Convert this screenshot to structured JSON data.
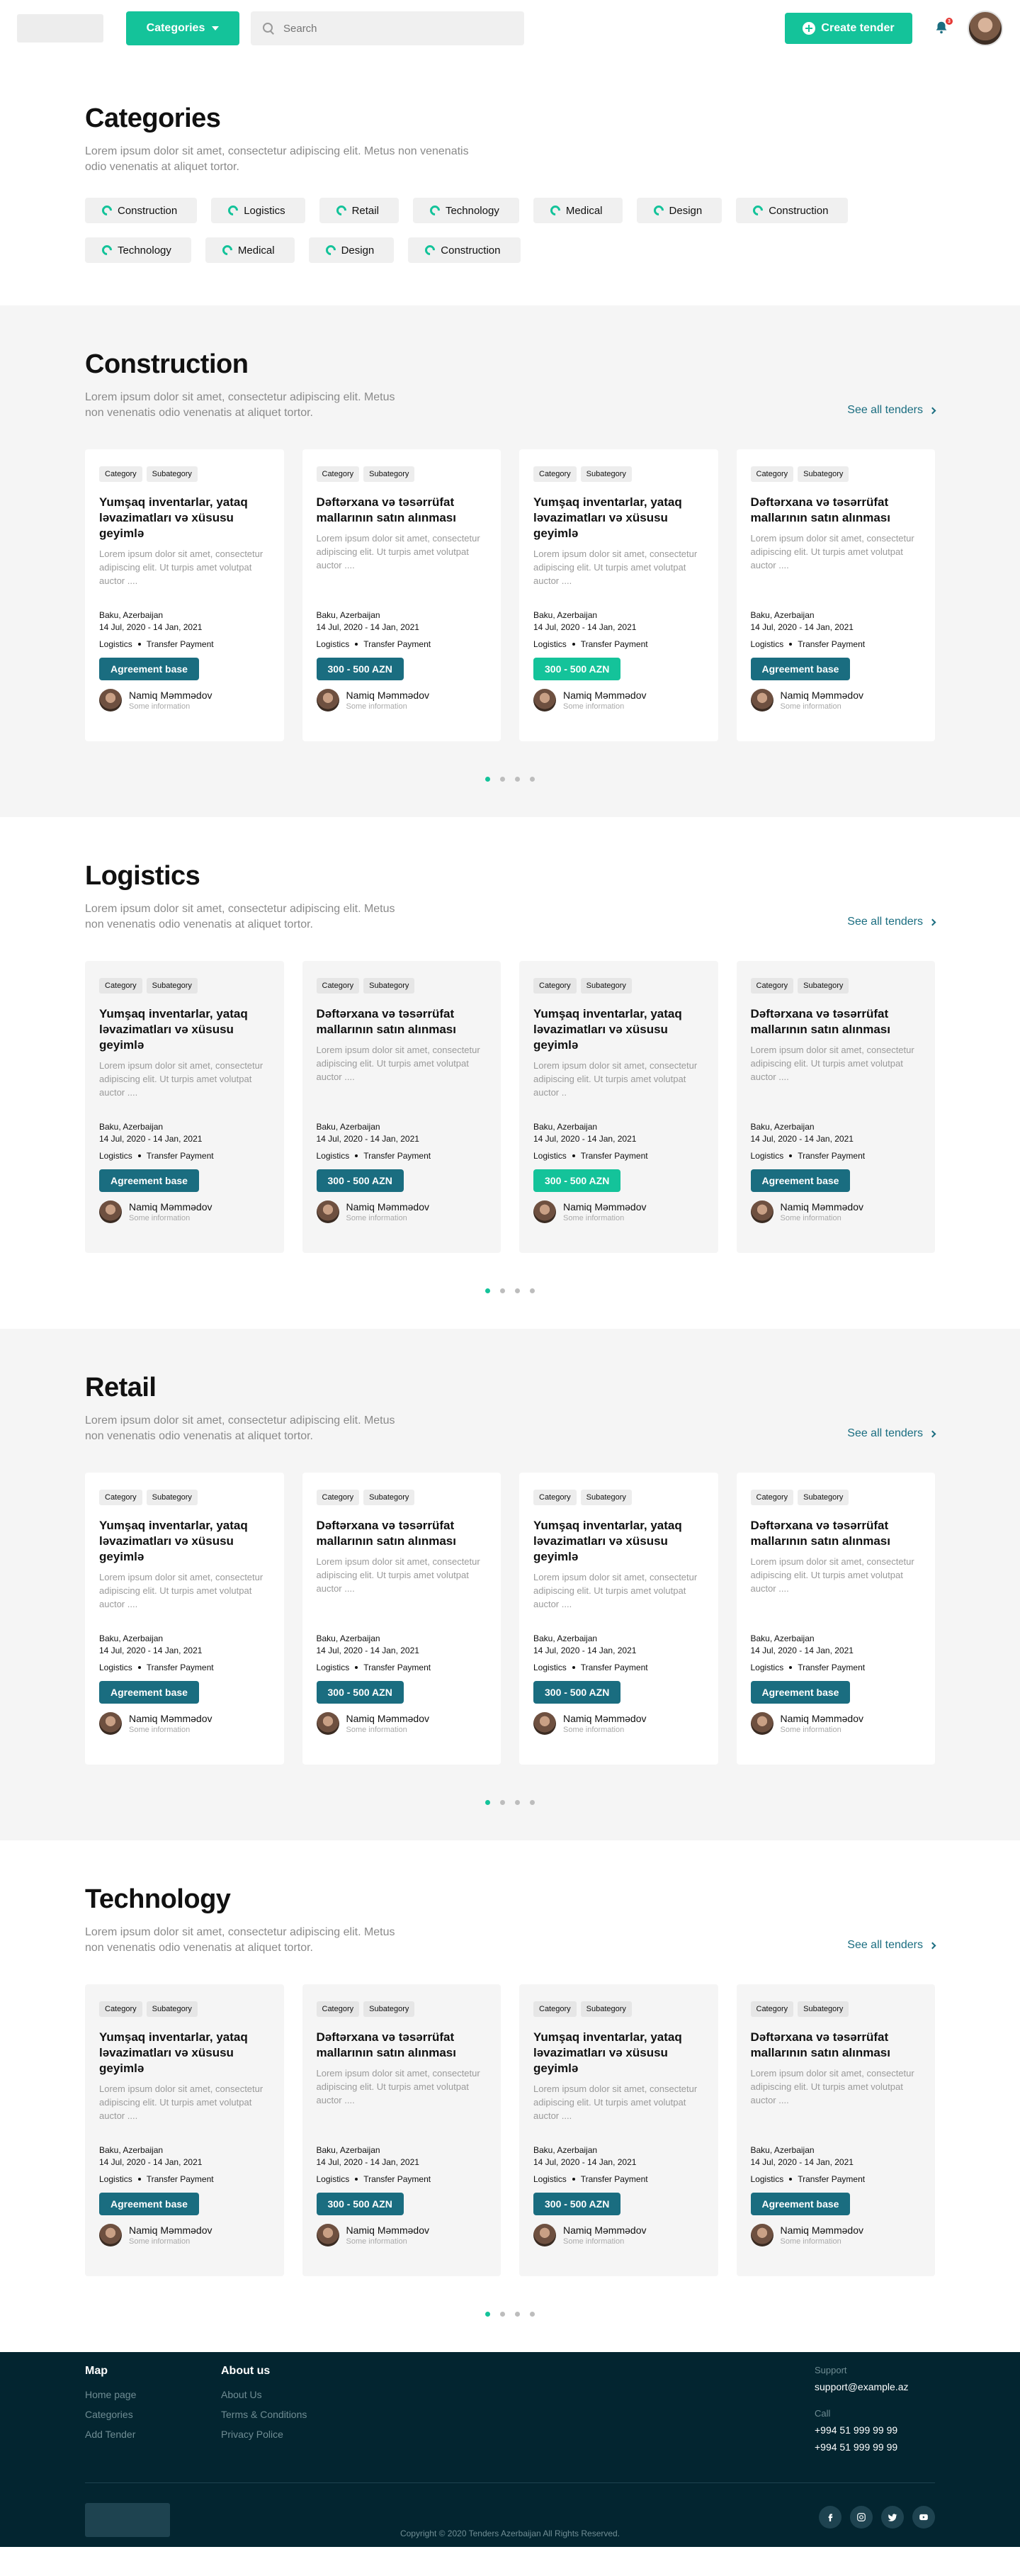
{
  "header": {
    "categories_label": "Categories",
    "search_placeholder": "Search",
    "create_label": "Create tender",
    "notification_count": "3"
  },
  "categories": {
    "title": "Categories",
    "description": "Lorem ipsum dolor sit amet, consectetur adipiscing elit. Metus non venenatis odio venenatis at aliquet tortor.",
    "chips": [
      "Construction",
      "Logistics",
      "Retail",
      "Technology",
      "Medical",
      "Design",
      "Construction",
      "Technology",
      "Medical",
      "Design",
      "Construction"
    ]
  },
  "sections": [
    {
      "title": "Construction",
      "description": "Lorem ipsum dolor sit amet, consectetur adipiscing elit. Metus non venenatis odio venenatis at aliquet tortor.",
      "see_all": "See all tenders",
      "cards": [
        {
          "category": "Category",
          "subcategory": "Subategory",
          "title": "Yumşaq inventarlar, yataq ləvazimatları və xüsusu geyimlə",
          "desc": "Lorem ipsum dolor sit amet, consectetur adipiscing elit. Ut turpis amet volutpat auctor ....",
          "location": "Baku, Azerbaijan",
          "dates": "14 Jul, 2020 - 14 Jan, 2021",
          "meta1": "Logistics",
          "meta2": "Transfer Payment",
          "price": "Agreement base",
          "user": "Namiq Məmmədov",
          "user_info": "Some information"
        },
        {
          "category": "Category",
          "subcategory": "Subategory",
          "title": "Dəftərxana və təsərrüfat mallarının satın alınması",
          "desc": "Lorem ipsum dolor sit amet, consectetur adipiscing elit. Ut turpis amet volutpat auctor ....",
          "location": "Baku, Azerbaijan",
          "dates": "14 Jul, 2020 - 14 Jan, 2021",
          "meta1": "Logistics",
          "meta2": "Transfer Payment",
          "price": "300 - 500 AZN",
          "user": "Namiq Məmmədov",
          "user_info": "Some information"
        },
        {
          "category": "Category",
          "subcategory": "Subategory",
          "title": "Yumşaq inventarlar, yataq ləvazimatları və xüsusu geyimlə",
          "desc": "Lorem ipsum dolor sit amet, consectetur adipiscing elit. Ut turpis amet volutpat auctor ....",
          "location": "Baku, Azerbaijan",
          "dates": "14 Jul, 2020 - 14 Jan, 2021",
          "meta1": "Logistics",
          "meta2": "Transfer Payment",
          "price": "300 - 500 AZN",
          "user": "Namiq Məmmədov",
          "user_info": "Some information"
        },
        {
          "category": "Category",
          "subcategory": "Subategory",
          "title": "Dəftərxana və təsərrüfat mallarının satın alınması",
          "desc": "Lorem ipsum dolor sit amet, consectetur adipiscing elit. Ut turpis amet volutpat auctor ....",
          "location": "Baku, Azerbaijan",
          "dates": "14 Jul, 2020 - 14 Jan, 2021",
          "meta1": "Logistics",
          "meta2": "Transfer Payment",
          "price": "Agreement base",
          "user": "Namiq Məmmədov",
          "user_info": "Some information"
        }
      ]
    },
    {
      "title": "Logistics",
      "description": "Lorem ipsum dolor sit amet, consectetur adipiscing elit. Metus non venenatis odio venenatis at aliquet tortor.",
      "see_all": "See all tenders",
      "cards": [
        {
          "category": "Category",
          "subcategory": "Subategory",
          "title": "Yumşaq inventarlar, yataq ləvazimatları və xüsusu geyimlə",
          "desc": "Lorem ipsum dolor sit amet, consectetur adipiscing elit. Ut turpis amet volutpat auctor ....",
          "location": "Baku, Azerbaijan",
          "dates": "14 Jul, 2020 - 14 Jan, 2021",
          "meta1": "Logistics",
          "meta2": "Transfer Payment",
          "price": "Agreement base",
          "user": "Namiq Məmmədov",
          "user_info": "Some information"
        },
        {
          "category": "Category",
          "subcategory": "Subategory",
          "title": "Dəftərxana və təsərrüfat mallarının satın alınması",
          "desc": "Lorem ipsum dolor sit amet, consectetur adipiscing elit. Ut turpis amet volutpat auctor ....",
          "location": "Baku, Azerbaijan",
          "dates": "14 Jul, 2020 - 14 Jan, 2021",
          "meta1": "Logistics",
          "meta2": "Transfer Payment",
          "price": "300 - 500 AZN",
          "user": "Namiq Məmmədov",
          "user_info": "Some information"
        },
        {
          "category": "Category",
          "subcategory": "Subategory",
          "title": "Yumşaq inventarlar, yataq ləvazimatları və xüsusu geyimlə",
          "desc": "Lorem ipsum dolor sit amet, consectetur adipiscing elit. Ut turpis amet volutpat auctor ..",
          "location": "Baku, Azerbaijan",
          "dates": "14 Jul, 2020 - 14 Jan, 2021",
          "meta1": "Logistics",
          "meta2": "Transfer Payment",
          "price": "300 - 500 AZN",
          "user": "Namiq Məmmədov",
          "user_info": "Some information"
        },
        {
          "category": "Category",
          "subcategory": "Subategory",
          "title": "Dəftərxana və təsərrüfat mallarının satın alınması",
          "desc": "Lorem ipsum dolor sit amet, consectetur adipiscing elit. Ut turpis amet volutpat auctor ....",
          "location": "Baku, Azerbaijan",
          "dates": "14 Jul, 2020 - 14 Jan, 2021",
          "meta1": "Logistics",
          "meta2": "Transfer Payment",
          "price": "Agreement base",
          "user": "Namiq Məmmədov",
          "user_info": "Some information"
        }
      ]
    },
    {
      "title": "Retail",
      "description": "Lorem ipsum dolor sit amet, consectetur adipiscing elit. Metus non venenatis odio venenatis at aliquet tortor.",
      "see_all": "See all tenders",
      "cards": [
        {
          "category": "Category",
          "subcategory": "Subategory",
          "title": "Yumşaq inventarlar, yataq ləvazimatları və xüsusu geyimlə",
          "desc": "Lorem ipsum dolor sit amet, consectetur adipiscing elit. Ut turpis amet volutpat auctor ....",
          "location": "Baku, Azerbaijan",
          "dates": "14 Jul, 2020 - 14 Jan, 2021",
          "meta1": "Logistics",
          "meta2": "Transfer Payment",
          "price": "Agreement base",
          "user": "Namiq Məmmədov",
          "user_info": "Some information"
        },
        {
          "category": "Category",
          "subcategory": "Subategory",
          "title": "Dəftərxana və təsərrüfat mallarının satın alınması",
          "desc": "Lorem ipsum dolor sit amet, consectetur adipiscing elit. Ut turpis amet volutpat auctor ....",
          "location": "Baku, Azerbaijan",
          "dates": "14 Jul, 2020 - 14 Jan, 2021",
          "meta1": "Logistics",
          "meta2": "Transfer Payment",
          "price": "300 - 500 AZN",
          "user": "Namiq Məmmədov",
          "user_info": "Some information"
        },
        {
          "category": "Category",
          "subcategory": "Subategory",
          "title": "Yumşaq inventarlar, yataq ləvazimatları və xüsusu geyimlə",
          "desc": "Lorem ipsum dolor sit amet, consectetur adipiscing elit. Ut turpis amet volutpat auctor ....",
          "location": "Baku, Azerbaijan",
          "dates": "14 Jul, 2020 - 14 Jan, 2021",
          "meta1": "Logistics",
          "meta2": "Transfer Payment",
          "price": "300 - 500 AZN",
          "user": "Namiq Məmmədov",
          "user_info": "Some information"
        },
        {
          "category": "Category",
          "subcategory": "Subategory",
          "title": "Dəftərxana və təsərrüfat mallarının satın alınması",
          "desc": "Lorem ipsum dolor sit amet, consectetur adipiscing elit. Ut turpis amet volutpat auctor ....",
          "location": "Baku, Azerbaijan",
          "dates": "14 Jul, 2020 - 14 Jan, 2021",
          "meta1": "Logistics",
          "meta2": "Transfer Payment",
          "price": "Agreement base",
          "user": "Namiq Məmmədov",
          "user_info": "Some information"
        }
      ]
    },
    {
      "title": "Technology",
      "description": "Lorem ipsum dolor sit amet, consectetur adipiscing elit. Metus non venenatis odio venenatis at aliquet tortor.",
      "see_all": "See all tenders",
      "cards": [
        {
          "category": "Category",
          "subcategory": "Subategory",
          "title": "Yumşaq inventarlar, yataq ləvazimatları və xüsusu geyimlə",
          "desc": "Lorem ipsum dolor sit amet, consectetur adipiscing elit. Ut turpis amet volutpat auctor ....",
          "location": "Baku, Azerbaijan",
          "dates": "14 Jul, 2020 - 14 Jan, 2021",
          "meta1": "Logistics",
          "meta2": "Transfer Payment",
          "price": "Agreement base",
          "user": "Namiq Məmmədov",
          "user_info": "Some information"
        },
        {
          "category": "Category",
          "subcategory": "Subategory",
          "title": "Dəftərxana və təsərrüfat mallarının satın alınması",
          "desc": "Lorem ipsum dolor sit amet, consectetur adipiscing elit. Ut turpis amet volutpat auctor ....",
          "location": "Baku, Azerbaijan",
          "dates": "14 Jul, 2020 - 14 Jan, 2021",
          "meta1": "Logistics",
          "meta2": "Transfer Payment",
          "price": "300 - 500 AZN",
          "user": "Namiq Məmmədov",
          "user_info": "Some information"
        },
        {
          "category": "Category",
          "subcategory": "Subategory",
          "title": "Yumşaq inventarlar, yataq ləvazimatları və xüsusu geyimlə",
          "desc": "Lorem ipsum dolor sit amet, consectetur adipiscing elit. Ut turpis amet volutpat auctor ....",
          "location": "Baku, Azerbaijan",
          "dates": "14 Jul, 2020 - 14 Jan, 2021",
          "meta1": "Logistics",
          "meta2": "Transfer Payment",
          "price": "300 - 500 AZN",
          "user": "Namiq Məmmədov",
          "user_info": "Some information"
        },
        {
          "category": "Category",
          "subcategory": "Subategory",
          "title": "Dəftərxana və təsərrüfat mallarının satın alınması",
          "desc": "Lorem ipsum dolor sit amet, consectetur adipiscing elit. Ut turpis amet volutpat auctor ....",
          "location": "Baku, Azerbaijan",
          "dates": "14 Jul, 2020 - 14 Jan, 2021",
          "meta1": "Logistics",
          "meta2": "Transfer Payment",
          "price": "Agreement base",
          "user": "Namiq Məmmədov",
          "user_info": "Some information"
        }
      ]
    }
  ],
  "footer": {
    "map_title": "Map",
    "map_links": [
      "Home page",
      "Categories",
      "Add Tender"
    ],
    "about_title": "About us",
    "about_links": [
      "About Us",
      "Terms & Conditions",
      "Privacy Police"
    ],
    "support_label": "Support",
    "support_email": "support@example.az",
    "call_label": "Call",
    "phone1": "+994 51 999 99 99",
    "phone2": "+994 51 999 99 99",
    "copyright": "Copyright © 2020 Tenders Azerbaijan All Rights Reserved."
  },
  "colors": {
    "accent": "#14c39a",
    "primary": "#1a6d80",
    "footer_bg": "#032530"
  }
}
